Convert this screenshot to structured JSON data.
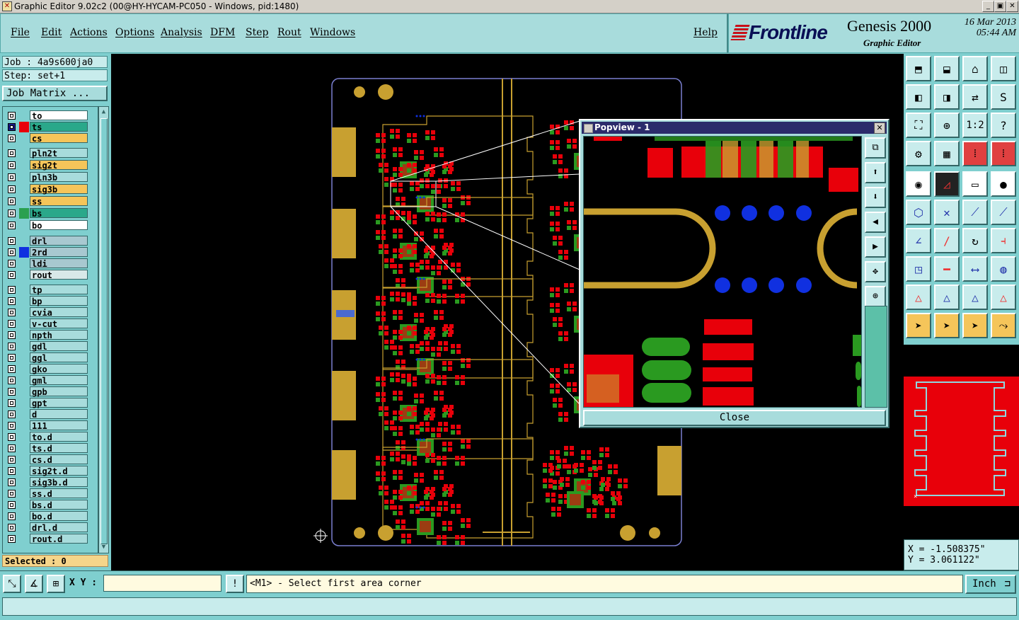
{
  "window": {
    "title": "Graphic Editor 9.02c2 (00@HY-HYCAM-PC050 - Windows, pid:1480)"
  },
  "menu": [
    "File",
    "Edit",
    "Actions",
    "Options",
    "Analysis",
    "DFM",
    "Step",
    "Rout",
    "Windows"
  ],
  "help_label": "Help",
  "brand": {
    "logo": "Frontline",
    "product": "Genesis 2000",
    "subtitle": "Graphic Editor",
    "date": "16 Mar 2013",
    "time": "05:44 AM"
  },
  "job": {
    "job_line": "Job : 4a9s600ja0",
    "step_line": "Step: set+1",
    "matrix_button": "Job Matrix ..."
  },
  "layers": [
    {
      "name": "to",
      "color": "#ffffff",
      "swatch": ""
    },
    {
      "name": "ts",
      "color": "#2aa88a",
      "swatch": "#e8000a",
      "active": true
    },
    {
      "name": "cs",
      "color": "#f5c55a",
      "swatch": ""
    },
    {
      "name": "pln2t",
      "color": "#a8dcdc",
      "swatch": ""
    },
    {
      "name": "sig2t",
      "color": "#f5c55a",
      "swatch": ""
    },
    {
      "name": "pln3b",
      "color": "#a8dcdc",
      "swatch": ""
    },
    {
      "name": "sig3b",
      "color": "#f5c55a",
      "swatch": ""
    },
    {
      "name": "ss",
      "color": "#f5c55a",
      "swatch": ""
    },
    {
      "name": "bs",
      "color": "#2aa88a",
      "swatch": "#2aa050"
    },
    {
      "name": "bo",
      "color": "#ffffff",
      "swatch": ""
    },
    {
      "name": "drl",
      "color": "#a8c8d0",
      "swatch": ""
    },
    {
      "name": "2rd",
      "color": "#a8c8d0",
      "swatch": "#1030e0"
    },
    {
      "name": "ldi",
      "color": "#a8c8d0",
      "swatch": ""
    },
    {
      "name": "rout",
      "color": "#d8e8e8",
      "swatch": ""
    },
    {
      "name": "tp",
      "color": "#a8dcdc",
      "swatch": ""
    },
    {
      "name": "bp",
      "color": "#a8dcdc",
      "swatch": ""
    },
    {
      "name": "cvia",
      "color": "#a8dcdc",
      "swatch": ""
    },
    {
      "name": "v-cut",
      "color": "#a8dcdc",
      "swatch": ""
    },
    {
      "name": "npth",
      "color": "#a8dcdc",
      "swatch": ""
    },
    {
      "name": "gdl",
      "color": "#a8dcdc",
      "swatch": ""
    },
    {
      "name": "ggl",
      "color": "#a8dcdc",
      "swatch": ""
    },
    {
      "name": "gko",
      "color": "#a8dcdc",
      "swatch": ""
    },
    {
      "name": "gml",
      "color": "#a8dcdc",
      "swatch": ""
    },
    {
      "name": "gpb",
      "color": "#a8dcdc",
      "swatch": ""
    },
    {
      "name": "gpt",
      "color": "#a8dcdc",
      "swatch": ""
    },
    {
      "name": "d",
      "color": "#a8dcdc",
      "swatch": ""
    },
    {
      "name": "111",
      "color": "#a8dcdc",
      "swatch": ""
    },
    {
      "name": "to.d",
      "color": "#a8dcdc",
      "swatch": ""
    },
    {
      "name": "ts.d",
      "color": "#a8dcdc",
      "swatch": ""
    },
    {
      "name": "cs.d",
      "color": "#a8dcdc",
      "swatch": ""
    },
    {
      "name": "sig2t.d",
      "color": "#a8dcdc",
      "swatch": ""
    },
    {
      "name": "sig3b.d",
      "color": "#a8dcdc",
      "swatch": ""
    },
    {
      "name": "ss.d",
      "color": "#a8dcdc",
      "swatch": ""
    },
    {
      "name": "bs.d",
      "color": "#a8dcdc",
      "swatch": ""
    },
    {
      "name": "bo.d",
      "color": "#a8dcdc",
      "swatch": ""
    },
    {
      "name": "drl.d",
      "color": "#a8dcdc",
      "swatch": ""
    },
    {
      "name": "rout.d",
      "color": "#a8dcdc",
      "swatch": ""
    }
  ],
  "selected_label": "Selected : 0",
  "popview": {
    "title": "Popview - 1",
    "close_label": "Close"
  },
  "coords": {
    "x": "X = -1.508375\"",
    "y": "Y = 3.061122\""
  },
  "bottom": {
    "xy_label": "X Y :",
    "xy_value": "",
    "message": "<M1> - Select first area corner",
    "unit": "Inch"
  },
  "colors": {
    "board": "#c8a030",
    "pad_red": "#e8000a",
    "pad_green": "#2a9a20",
    "via_blue": "#1030e0",
    "panel_bg": "#7fcfcf"
  }
}
